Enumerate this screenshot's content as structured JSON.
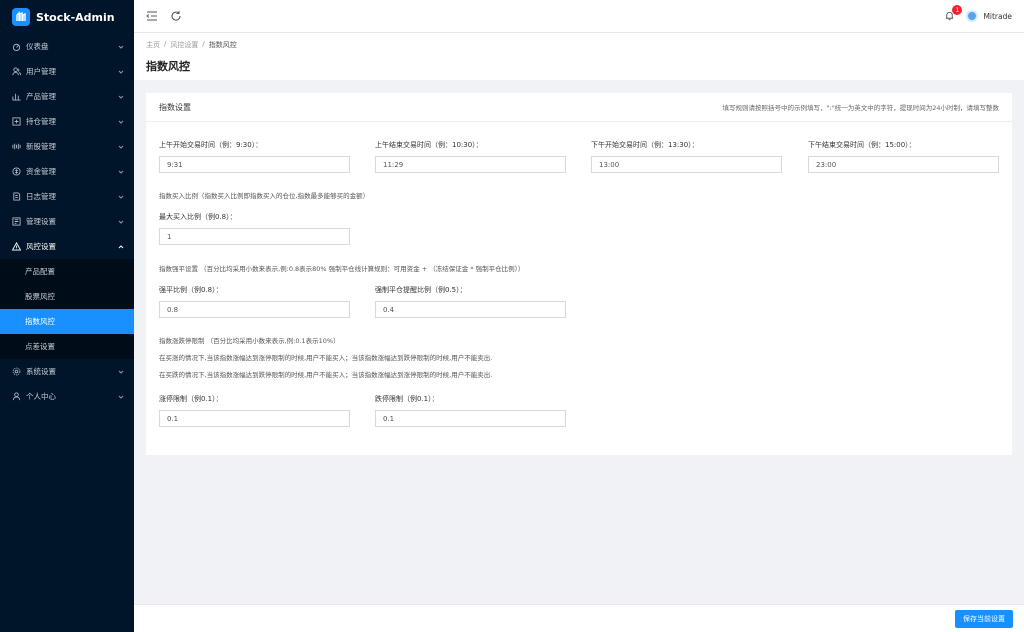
{
  "app": {
    "title": "Stock-Admin"
  },
  "sidebar": {
    "items": [
      {
        "label": "仪表盘",
        "icon": "dashboard-icon"
      },
      {
        "label": "用户管理",
        "icon": "users-icon"
      },
      {
        "label": "产品管理",
        "icon": "product-icon"
      },
      {
        "label": "持仓管理",
        "icon": "position-icon"
      },
      {
        "label": "新股管理",
        "icon": "ipo-icon"
      },
      {
        "label": "资金管理",
        "icon": "fund-icon"
      },
      {
        "label": "日志管理",
        "icon": "log-icon"
      },
      {
        "label": "管理设置",
        "icon": "admin-settings-icon"
      },
      {
        "label": "风控设置",
        "icon": "warning-icon"
      }
    ],
    "risk_submenu": [
      {
        "label": "产品配置"
      },
      {
        "label": "股票风控"
      },
      {
        "label": "指数风控"
      },
      {
        "label": "点差设置"
      }
    ],
    "bottom_items": [
      {
        "label": "系统设置",
        "icon": "gear-icon"
      },
      {
        "label": "个人中心",
        "icon": "user-icon"
      }
    ]
  },
  "header": {
    "badge": "1",
    "username": "Mitrade"
  },
  "breadcrumb": {
    "home": "主页",
    "sep": "/",
    "parent": "风控设置",
    "current": "指数风控"
  },
  "page": {
    "title": "指数风控"
  },
  "card": {
    "title": "指数设置",
    "hint": "填写规则请按照括号中的示例填写，\":\"统一为英文中的字符，提现时间为24小时制，请填写整数"
  },
  "form": {
    "am_open": {
      "label": "上午开始交易时间（例：9:30）：",
      "value": "9:31"
    },
    "am_close": {
      "label": "上午结束交易时间（例：10:30）：",
      "value": "11:29"
    },
    "pm_open": {
      "label": "下午开始交易时间（例：13:30）：",
      "value": "13:00"
    },
    "pm_close": {
      "label": "下午结束交易时间（例：15:00）：",
      "value": "23:00"
    },
    "buy_ratio_note": "指数买入比例（指数买入比例即指数买入的仓位,指数最多能够买的金额）",
    "max_buy": {
      "label": "最大买入比例（例0.8）：",
      "value": "1"
    },
    "force_close_note": "指数强平设置 （百分比均采用小数来表示,例:0.8表示80% 强制平仓线计算规则：可用资金 + （冻结保证金 * 强制平仓比例））",
    "force_ratio": {
      "label": "强平比例（例0.8）：",
      "value": "0.8"
    },
    "force_warn": {
      "label": "强制平仓提醒比例（例0.5）：",
      "value": "0.4"
    },
    "limit_note": "指数涨跌停限制 （百分比均采用小数来表示,例:0.1表示10%）",
    "limit_up_note": "在买涨的情况下,当该指数涨幅达到涨停限制的时候,用户不能买入；当该指数涨幅达到跌停限制的时候,用户不能卖出.",
    "limit_down_note": "在买跌的情况下,当该指数涨幅达到跌停限制的时候,用户不能买入；当该指数涨幅达到涨停限制的时候,用户不能卖出.",
    "up_limit": {
      "label": "涨停限制（例0.1）：",
      "value": "0.1"
    },
    "down_limit": {
      "label": "跌停限制（例0.1）：",
      "value": "0.1"
    }
  },
  "footer": {
    "save_label": "保存当前设置"
  },
  "colors": {
    "sidebar": "#001529",
    "accent": "#1890ff",
    "badge": "#f5222d"
  }
}
